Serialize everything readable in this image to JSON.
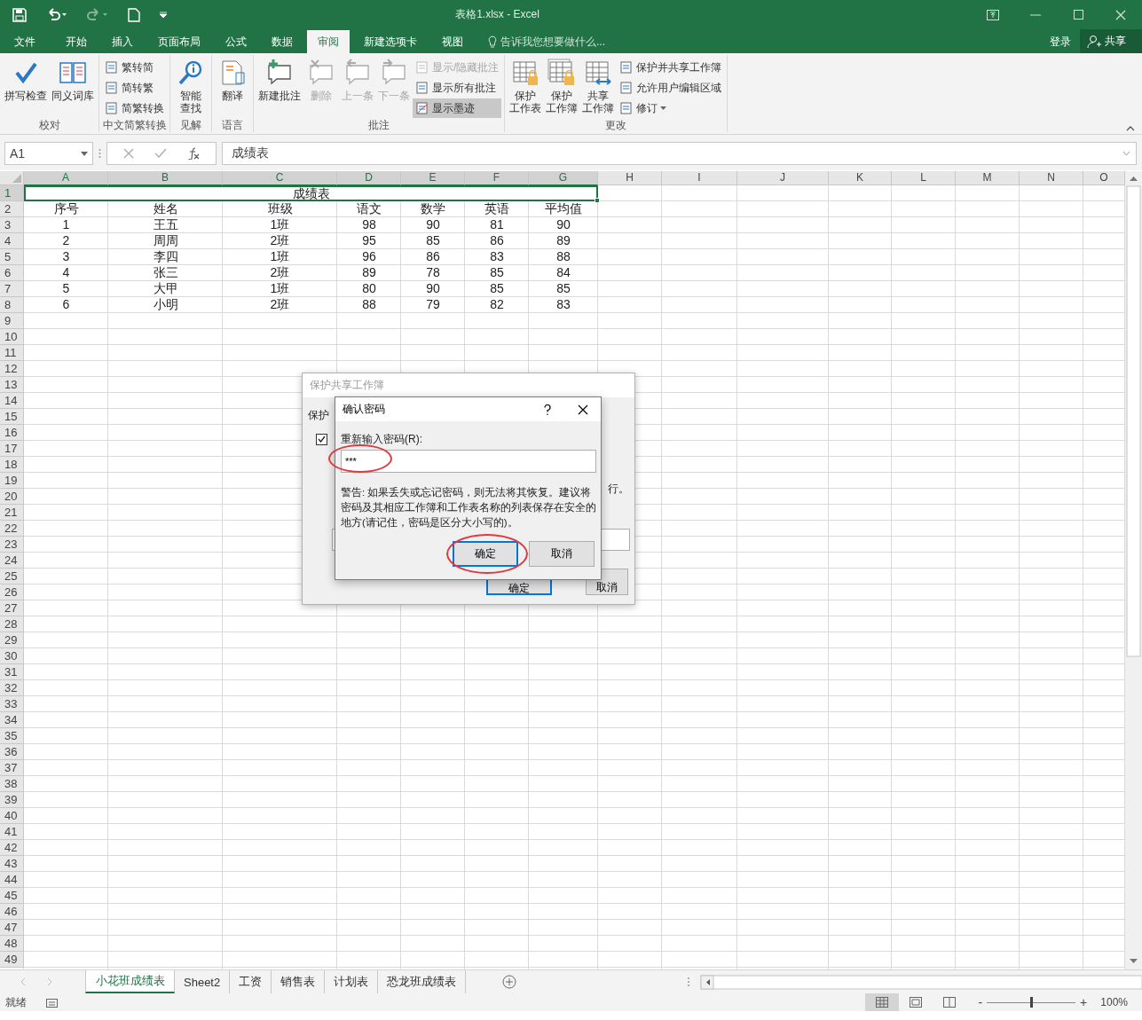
{
  "window": {
    "title": "表格1.xlsx - Excel"
  },
  "ribbon_tabs": [
    {
      "label": "文件",
      "selected": false
    },
    {
      "label": "开始",
      "selected": false
    },
    {
      "label": "插入",
      "selected": false
    },
    {
      "label": "页面布局",
      "selected": false
    },
    {
      "label": "公式",
      "selected": false
    },
    {
      "label": "数据",
      "selected": false
    },
    {
      "label": "审阅",
      "selected": true
    },
    {
      "label": "新建选项卡",
      "selected": false
    },
    {
      "label": "视图",
      "selected": false
    }
  ],
  "tell_me": {
    "placeholder": "告诉我您想要做什么..."
  },
  "account": {
    "sign_in": "登录",
    "share": "共享"
  },
  "ribbon_groups": [
    {
      "label": "校对",
      "items": [
        {
          "kind": "large",
          "lines": [
            "拼写检查"
          ],
          "disabled": false,
          "selected": false
        },
        {
          "kind": "large",
          "lines": [
            "同义词库"
          ],
          "disabled": false,
          "selected": false
        }
      ]
    },
    {
      "label": "中文简繁转换",
      "items": [
        {
          "kind": "small",
          "lines": [
            "繁转简"
          ],
          "disabled": false,
          "selected": false
        },
        {
          "kind": "small",
          "lines": [
            "简转繁"
          ],
          "disabled": false,
          "selected": false
        },
        {
          "kind": "small",
          "lines": [
            "简繁转换"
          ],
          "disabled": false,
          "selected": false
        }
      ]
    },
    {
      "label": "见解",
      "items": [
        {
          "kind": "large",
          "lines": [
            "智能",
            "查找"
          ],
          "disabled": false,
          "selected": false
        }
      ]
    },
    {
      "label": "语言",
      "items": [
        {
          "kind": "large",
          "lines": [
            "翻译"
          ],
          "disabled": false,
          "selected": false
        }
      ]
    },
    {
      "label": "批注",
      "items": [
        {
          "kind": "large",
          "lines": [
            "新建批注"
          ],
          "disabled": false,
          "selected": false
        },
        {
          "kind": "large",
          "lines": [
            "删除"
          ],
          "disabled": true,
          "selected": false
        },
        {
          "kind": "large",
          "lines": [
            "上一条"
          ],
          "disabled": true,
          "selected": false
        },
        {
          "kind": "large",
          "lines": [
            "下一条"
          ],
          "disabled": true,
          "selected": false
        },
        {
          "kind": "small",
          "lines": [
            "显示/隐藏批注"
          ],
          "disabled": true,
          "selected": false
        },
        {
          "kind": "small",
          "lines": [
            "显示所有批注"
          ],
          "disabled": false,
          "selected": false
        },
        {
          "kind": "small",
          "lines": [
            "显示墨迹"
          ],
          "disabled": false,
          "selected": true
        }
      ]
    },
    {
      "label": "更改",
      "items": [
        {
          "kind": "large",
          "lines": [
            "保护",
            "工作表"
          ],
          "disabled": false,
          "selected": false
        },
        {
          "kind": "large",
          "lines": [
            "保护",
            "工作簿"
          ],
          "disabled": false,
          "selected": false
        },
        {
          "kind": "large",
          "lines": [
            "共享",
            "工作簿"
          ],
          "disabled": false,
          "selected": false
        },
        {
          "kind": "small",
          "lines": [
            "保护并共享工作簿"
          ],
          "disabled": false,
          "selected": false
        },
        {
          "kind": "small",
          "lines": [
            "允许用户编辑区域"
          ],
          "disabled": false,
          "selected": false
        },
        {
          "kind": "small",
          "lines": [
            "修订"
          ],
          "disabled": false,
          "selected": false
        }
      ]
    }
  ],
  "formula_bar": {
    "name_box": "A1",
    "formula": "成绩表"
  },
  "sheet": {
    "columns": [
      "A",
      "B",
      "C",
      "D",
      "E",
      "F",
      "G",
      "H",
      "I",
      "J",
      "K",
      "L",
      "M",
      "N",
      "O"
    ],
    "title_row": {
      "number": "1",
      "text": "成绩表"
    },
    "rows": [
      {
        "number": "2",
        "cells": [
          "序号",
          "姓名",
          "班级",
          "语文",
          "数学",
          "英语",
          "平均值"
        ]
      },
      {
        "number": "3",
        "cells": [
          "1",
          "王五",
          "1班",
          "98",
          "90",
          "81",
          "90"
        ]
      },
      {
        "number": "4",
        "cells": [
          "2",
          "周周",
          "2班",
          "95",
          "85",
          "86",
          "89"
        ]
      },
      {
        "number": "5",
        "cells": [
          "3",
          "李四",
          "1班",
          "96",
          "86",
          "83",
          "88"
        ]
      },
      {
        "number": "6",
        "cells": [
          "4",
          "张三",
          "2班",
          "89",
          "78",
          "85",
          "84"
        ]
      },
      {
        "number": "7",
        "cells": [
          "5",
          "大甲",
          "1班",
          "80",
          "90",
          "85",
          "85"
        ]
      },
      {
        "number": "8",
        "cells": [
          "6",
          "小明",
          "2班",
          "88",
          "79",
          "82",
          "83"
        ]
      }
    ],
    "empty_rows": [
      "9",
      "10",
      "11",
      "12",
      "13",
      "14",
      "15",
      "16",
      "17",
      "18",
      "19",
      "20",
      "21",
      "22",
      "23",
      "24",
      "25",
      "26",
      "27",
      "28",
      "29",
      "30",
      "31",
      "32",
      "33",
      "34",
      "35",
      "36",
      "37",
      "38",
      "39",
      "40",
      "41",
      "42",
      "43",
      "44",
      "45",
      "46",
      "47",
      "48",
      "49"
    ]
  },
  "back_dialog": {
    "title": "保护共享工作簿",
    "section": "保护",
    "checkbox": {
      "checked": true
    },
    "line_end": "行。",
    "buttons": [
      "确定",
      "取消"
    ]
  },
  "front_dialog": {
    "title": "确认密码",
    "field_label": "重新输入密码(R):",
    "password_field": {
      "value": "***",
      "circled": true
    },
    "warning": "警告: 如果丢失或忘记密码，则无法将其恢复。建议将密码及其相应工作簿和工作表名称的列表保存在安全的地方(请记住，密码是区分大小写的)。",
    "buttons": [
      {
        "label": "确定",
        "default": true,
        "circled": true
      },
      {
        "label": "取消",
        "default": false,
        "circled": false
      }
    ]
  },
  "sheet_tabs": [
    {
      "label": "小花班成绩表",
      "selected": true
    },
    {
      "label": "Sheet2",
      "selected": false
    },
    {
      "label": "工资",
      "selected": false
    },
    {
      "label": "销售表",
      "selected": false
    },
    {
      "label": "计划表",
      "selected": false
    },
    {
      "label": "恐龙班成绩表",
      "selected": false
    }
  ],
  "status_bar": {
    "status": "就绪",
    "views": [
      {
        "selected": true
      },
      {
        "selected": false
      },
      {
        "selected": false
      }
    ],
    "zoom": {
      "level": 0.5,
      "reading": "100%",
      "minus": "-",
      "plus": "+"
    }
  }
}
